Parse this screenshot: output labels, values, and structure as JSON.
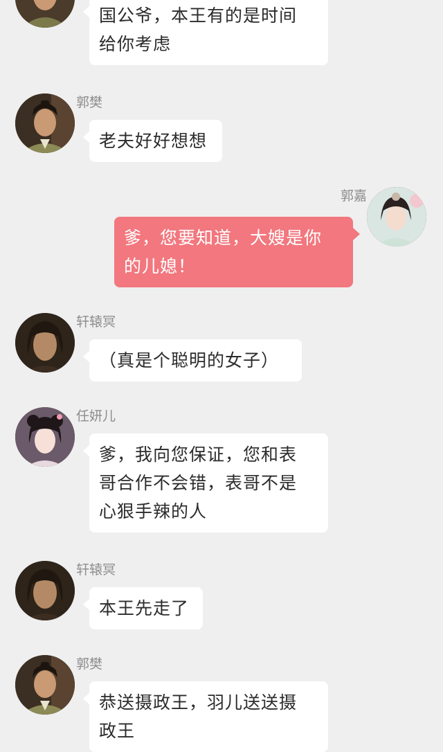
{
  "messages": [
    {
      "side": "left",
      "speaker": "",
      "lines": [
        "国公爷，本王有的是时间",
        "给你考虑"
      ],
      "avatar": "guo-fan-avatar"
    },
    {
      "side": "left",
      "speaker": "郭樊",
      "lines": [
        "老夫好好想想"
      ],
      "avatar": "guo-fan-avatar"
    },
    {
      "side": "right",
      "speaker": "郭嘉",
      "lines": [
        "爹，您要知道，大嫂是你",
        "的儿媳！"
      ],
      "avatar": "guo-jia-avatar"
    },
    {
      "side": "left",
      "speaker": "轩辕冥",
      "lines": [
        "（真是个聪明的女子）"
      ],
      "avatar": "xuanyuan-ming-avatar"
    },
    {
      "side": "left",
      "speaker": "任妍儿",
      "lines": [
        "爹，我向您保证，您和表",
        "哥合作不会错，表哥不是",
        "心狠手辣的人"
      ],
      "avatar": "ren-yaner-avatar"
    },
    {
      "side": "left",
      "speaker": "轩辕冥",
      "lines": [
        "本王先走了"
      ],
      "avatar": "xuanyuan-ming-avatar"
    },
    {
      "side": "left",
      "speaker": "郭樊",
      "lines": [
        "恭送摄政王，羽儿送送摄",
        "政王"
      ],
      "avatar": "guo-fan-avatar"
    }
  ],
  "colors": {
    "background": "#efefef",
    "bubble_left": "#ffffff",
    "bubble_right": "#f2777e",
    "name_text": "#8d8d8d"
  }
}
